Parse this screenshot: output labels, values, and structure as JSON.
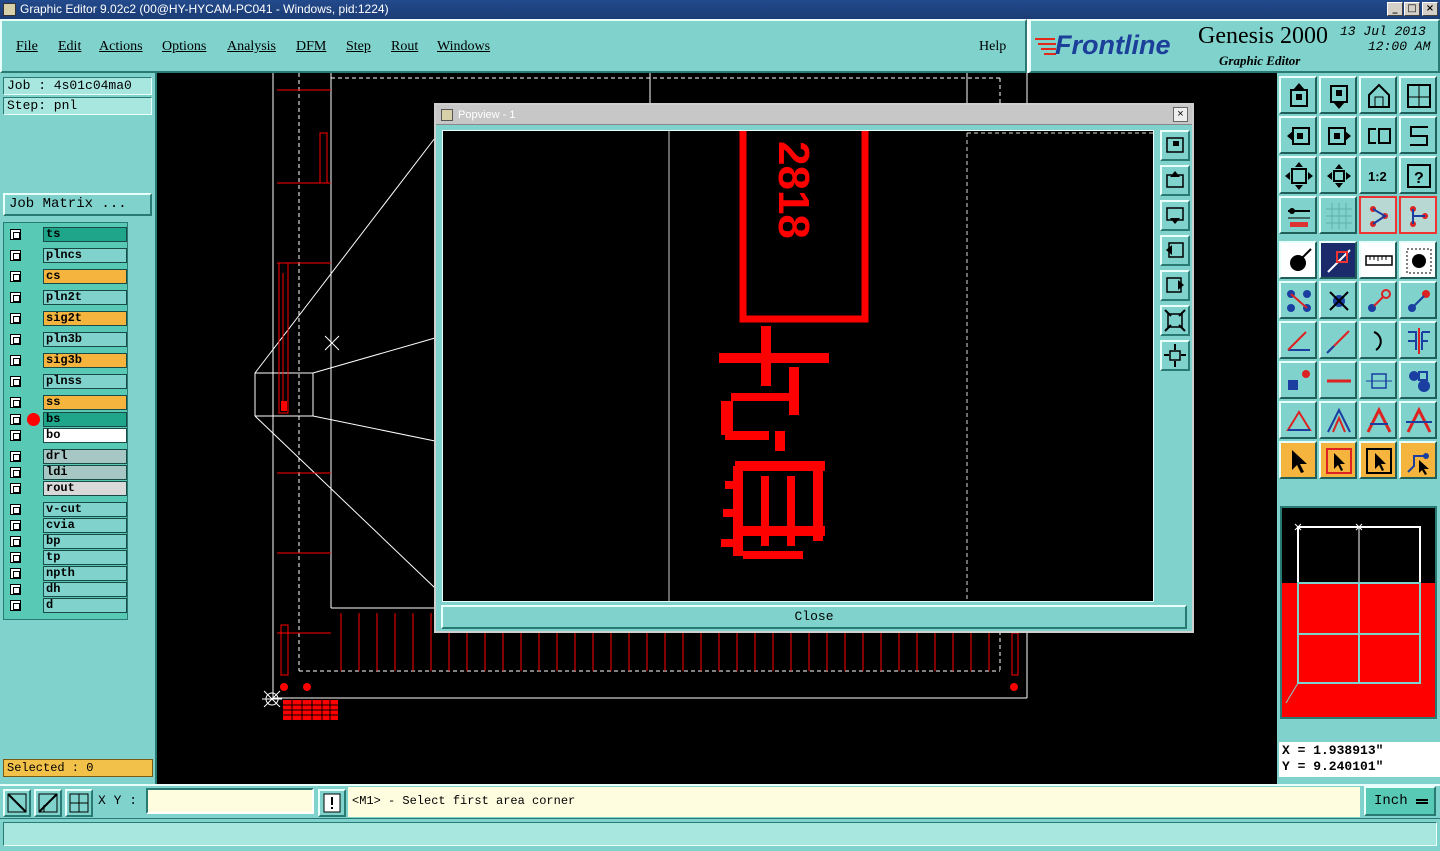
{
  "window": {
    "title": "Graphic Editor 9.02c2 (00@HY-HYCAM-PC041 - Windows, pid:1224)"
  },
  "menu": [
    {
      "label": "File"
    },
    {
      "label": "Edit"
    },
    {
      "label": "Actions"
    },
    {
      "label": "Options"
    },
    {
      "label": "Analysis"
    },
    {
      "label": "DFM"
    },
    {
      "label": "Step"
    },
    {
      "label": "Rout"
    },
    {
      "label": "Windows"
    },
    {
      "label": "Help"
    }
  ],
  "brand": {
    "logo": "Frontline",
    "product": "Genesis 2000",
    "subtitle": "Graphic Editor",
    "date": "13 Jul 2013",
    "time": "12:00 AM"
  },
  "job": {
    "job_label": "Job : 4s01c04ma0",
    "step_label": "Step: pnl",
    "matrix_button": "Job Matrix ..."
  },
  "layers": [
    {
      "name": "ts",
      "color": "#1fa589"
    },
    {
      "name": "plncs",
      "color": "#7fd3cc"
    },
    {
      "name": "cs",
      "color": "#f4b43e"
    },
    {
      "name": "pln2t",
      "color": "#7fd3cc"
    },
    {
      "name": "sig2t",
      "color": "#f4b43e"
    },
    {
      "name": "pln3b",
      "color": "#7fd3cc"
    },
    {
      "name": "sig3b",
      "color": "#f4b43e"
    },
    {
      "name": "plnss",
      "color": "#7fd3cc"
    },
    {
      "name": "ss",
      "color": "#f4b43e"
    },
    {
      "name": "bs",
      "color": "#1fa589"
    },
    {
      "name": "bo",
      "color": "#ffffff"
    },
    {
      "name": "drl",
      "color": "#a7c7c4"
    },
    {
      "name": "ldi",
      "color": "#a7c7c4"
    },
    {
      "name": "rout",
      "color": "#d9d9d9"
    },
    {
      "name": "v-cut",
      "color": "#7fd3cc"
    },
    {
      "name": "cvia",
      "color": "#7fd3cc"
    },
    {
      "name": "bp",
      "color": "#7fd3cc"
    },
    {
      "name": "tp",
      "color": "#7fd3cc"
    },
    {
      "name": "npth",
      "color": "#7fd3cc"
    },
    {
      "name": "dh",
      "color": "#7fd3cc"
    },
    {
      "name": "d",
      "color": "#7fd3cc"
    }
  ],
  "selected_label": "Selected : 0",
  "popview": {
    "title": "Popview - 1",
    "close_label": "Close",
    "stamp_text": "2818"
  },
  "coords": {
    "x": "X = 1.938913\"",
    "y": "Y = 9.240101\""
  },
  "bottom": {
    "xy_label": "X Y :",
    "xy_value": "",
    "prompt": "<M1> - Select first area corner",
    "unit": "Inch"
  },
  "colors": {
    "panel": "#7fd3cc",
    "accent": "#f4b43e",
    "board_red": "#ff0000"
  }
}
